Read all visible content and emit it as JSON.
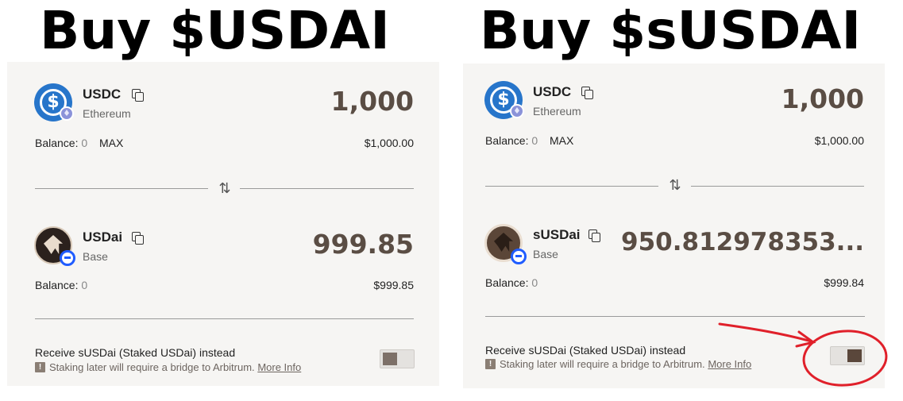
{
  "left": {
    "heading": "Buy $USDAI",
    "from": {
      "symbol": "USDC",
      "chain": "Ethereum",
      "amount": "1,000",
      "balance_label": "Balance:",
      "balance_value": "0",
      "max_label": "MAX",
      "usd_value": "$1,000.00"
    },
    "to": {
      "symbol": "USDai",
      "chain": "Base",
      "amount": "999.85",
      "balance_label": "Balance:",
      "balance_value": "0",
      "usd_value": "$999.85"
    },
    "receive_label": "Receive sUSDai (Staked USDai) instead",
    "warning_text": "Staking later will require a bridge to Arbitrum.",
    "more_info": "More Info",
    "toggle_on": false
  },
  "right": {
    "heading": "Buy $sUSDAI",
    "from": {
      "symbol": "USDC",
      "chain": "Ethereum",
      "amount": "1,000",
      "balance_label": "Balance:",
      "balance_value": "0",
      "max_label": "MAX",
      "usd_value": "$1,000.00"
    },
    "to": {
      "symbol": "sUSDai",
      "chain": "Base",
      "amount": "950.812978353...",
      "balance_label": "Balance:",
      "balance_value": "0",
      "usd_value": "$999.84"
    },
    "receive_label": "Receive sUSDai (Staked USDai) instead",
    "warning_text": "Staking later will require a bridge to Arbitrum.",
    "more_info": "More Info",
    "toggle_on": true
  },
  "icons": {
    "usdc": "usdc-token-icon",
    "ethereum": "ethereum-badge-icon",
    "usdai": "usdai-token-icon",
    "susdai": "susdai-token-icon",
    "base": "base-badge-icon",
    "copy": "copy-icon",
    "swap": "swap-arrows-icon",
    "warning": "warning-icon"
  },
  "colors": {
    "panel_bg": "#f6f5f3",
    "usdc_blue": "#2775ca",
    "amount_brown": "#5a4d44",
    "annotation_red": "#e0202a"
  }
}
